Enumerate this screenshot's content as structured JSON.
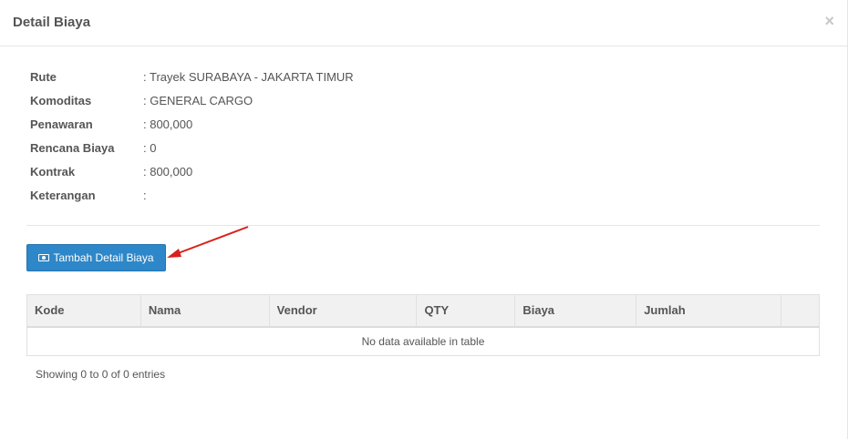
{
  "modal": {
    "title": "Detail Biaya",
    "close_label": "×"
  },
  "details": [
    {
      "label": "Rute",
      "value": ": Trayek SURABAYA - JAKARTA TIMUR"
    },
    {
      "label": "Komoditas",
      "value": ": GENERAL CARGO"
    },
    {
      "label": "Penawaran",
      "value": ": 800,000"
    },
    {
      "label": "Rencana Biaya",
      "value": ": 0"
    },
    {
      "label": "Kontrak",
      "value": ": 800,000"
    },
    {
      "label": "Keterangan",
      "value": ":"
    }
  ],
  "add_button": {
    "label": "Tambah Detail Biaya",
    "icon": "money-icon",
    "color": "#2d87c8"
  },
  "annotation": {
    "arrow_color": "#d9201a"
  },
  "table": {
    "columns": [
      "Kode",
      "Nama",
      "Vendor",
      "QTY",
      "Biaya",
      "Jumlah",
      ""
    ],
    "empty_message": "No data available in table"
  },
  "footer": {
    "showing": "Showing 0 to 0 of 0 entries"
  }
}
